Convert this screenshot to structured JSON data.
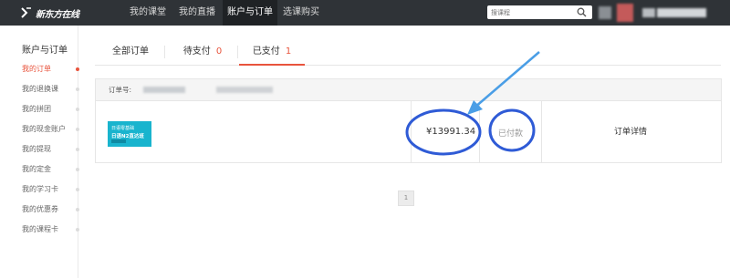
{
  "header": {
    "logo_text": "新东方在线",
    "nav": [
      "我的课堂",
      "我的直播",
      "账户与订单",
      "选课购买"
    ],
    "active_nav_index": 2,
    "search_placeholder": "搜课程"
  },
  "sidebar": {
    "title": "账户与订单",
    "items": [
      "我的订单",
      "我的退换课",
      "我的拼团",
      "我的现金账户",
      "我的提现",
      "我的定金",
      "我的学习卡",
      "我的优惠券",
      "我的课程卡"
    ],
    "active_index": 0
  },
  "tabs": [
    {
      "label": "全部订单",
      "count": ""
    },
    {
      "label": "待支付",
      "count": "0"
    },
    {
      "label": "已支付",
      "count": "1"
    }
  ],
  "active_tab_index": 2,
  "order": {
    "number_label": "订单号:",
    "thumbnail_line1": "日语零基础",
    "thumbnail_line2": "日语N2直达班",
    "price": "¥13991.34",
    "status": "已付款",
    "detail_link": "订单详情"
  },
  "pagination": {
    "current_page": "1"
  },
  "colors": {
    "topbar": "#2f3337",
    "accent": "#e8543d",
    "annotation_blue": "#2f5bd6",
    "arrow_blue": "#4a9ee6",
    "thumbnail": "#19b4ce"
  }
}
